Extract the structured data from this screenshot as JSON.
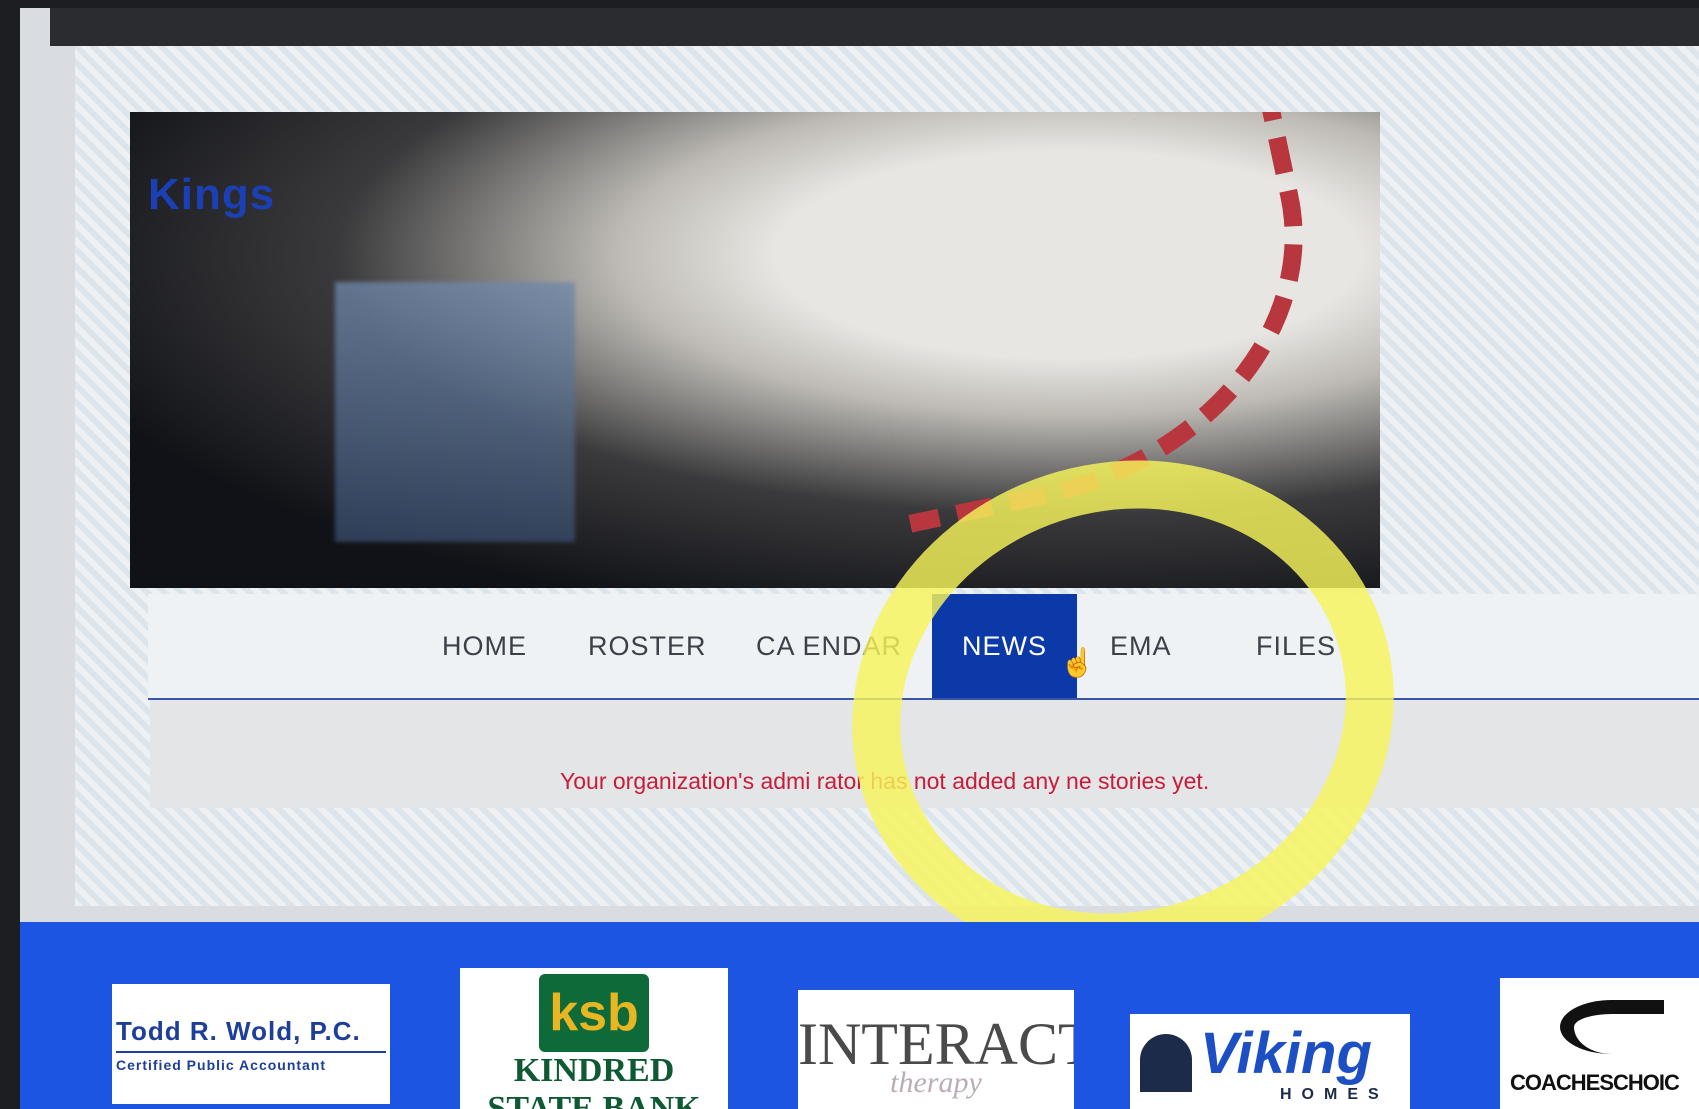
{
  "site": {
    "team_name": "Kings"
  },
  "nav": {
    "items": [
      {
        "label": "HOME"
      },
      {
        "label": "ROSTER"
      },
      {
        "label": "CA  ENDAR"
      },
      {
        "label": "NEWS"
      },
      {
        "label": "EMA"
      },
      {
        "label": "FILES"
      }
    ],
    "active_label": "NEWS"
  },
  "content": {
    "empty_message": "Your organization's admi         rator has not added any ne     stories yet."
  },
  "sponsors": {
    "wold": {
      "line1": "Todd R. Wold, P.C.",
      "line2": "Certified Public Accountant"
    },
    "kindred": {
      "monogram": "ksb",
      "name": "KINDRED",
      "name2": "STATE BANK"
    },
    "interact": {
      "name": "INTERACT",
      "sub": "therapy"
    },
    "viking": {
      "name": "Viking",
      "sub": "HOMES"
    },
    "coaches": {
      "name": "COACHESCHOIC"
    }
  },
  "colors": {
    "nav_active": "#0b3aa8",
    "message": "#c81c3a",
    "sponsor_band": "#1b55e2",
    "highlight": "#f6f45a"
  }
}
